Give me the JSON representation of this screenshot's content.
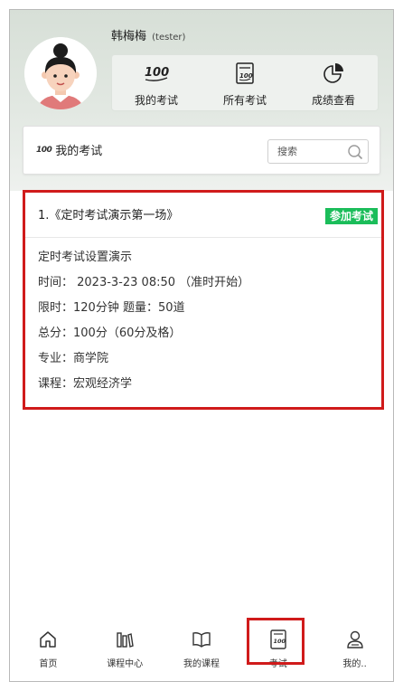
{
  "user": {
    "name": "韩梅梅",
    "tag": "(tester)"
  },
  "quick_links": [
    {
      "label": "我的考试",
      "icon": "score-100-icon"
    },
    {
      "label": "所有考试",
      "icon": "exam-paper-icon"
    },
    {
      "label": "成绩查看",
      "icon": "pie-chart-icon"
    }
  ],
  "search": {
    "title_badge": "100",
    "title": "我的考试",
    "placeholder": "搜索"
  },
  "exam": {
    "name": "1.《定时考试演示第一场》",
    "join_label": "参加考试",
    "description": "定时考试设置演示",
    "time": "时间： 2023-3-23 08:50 （准时开始）",
    "limit": "限时：120分钟   题量：50道",
    "score": "总分：100分（60分及格）",
    "major": "专业：商学院",
    "course": "课程：宏观经济学"
  },
  "tabs": [
    {
      "label": "首页",
      "icon": "home-icon"
    },
    {
      "label": "课程中心",
      "icon": "books-icon"
    },
    {
      "label": "我的课程",
      "icon": "open-book-icon"
    },
    {
      "label": "考试",
      "icon": "exam-paper-icon"
    },
    {
      "label": "我的..",
      "icon": "user-icon"
    }
  ],
  "colors": {
    "accent_green": "#1bbd5a",
    "highlight_red": "#d01b1b",
    "header_bg": "#d7dfd7"
  }
}
